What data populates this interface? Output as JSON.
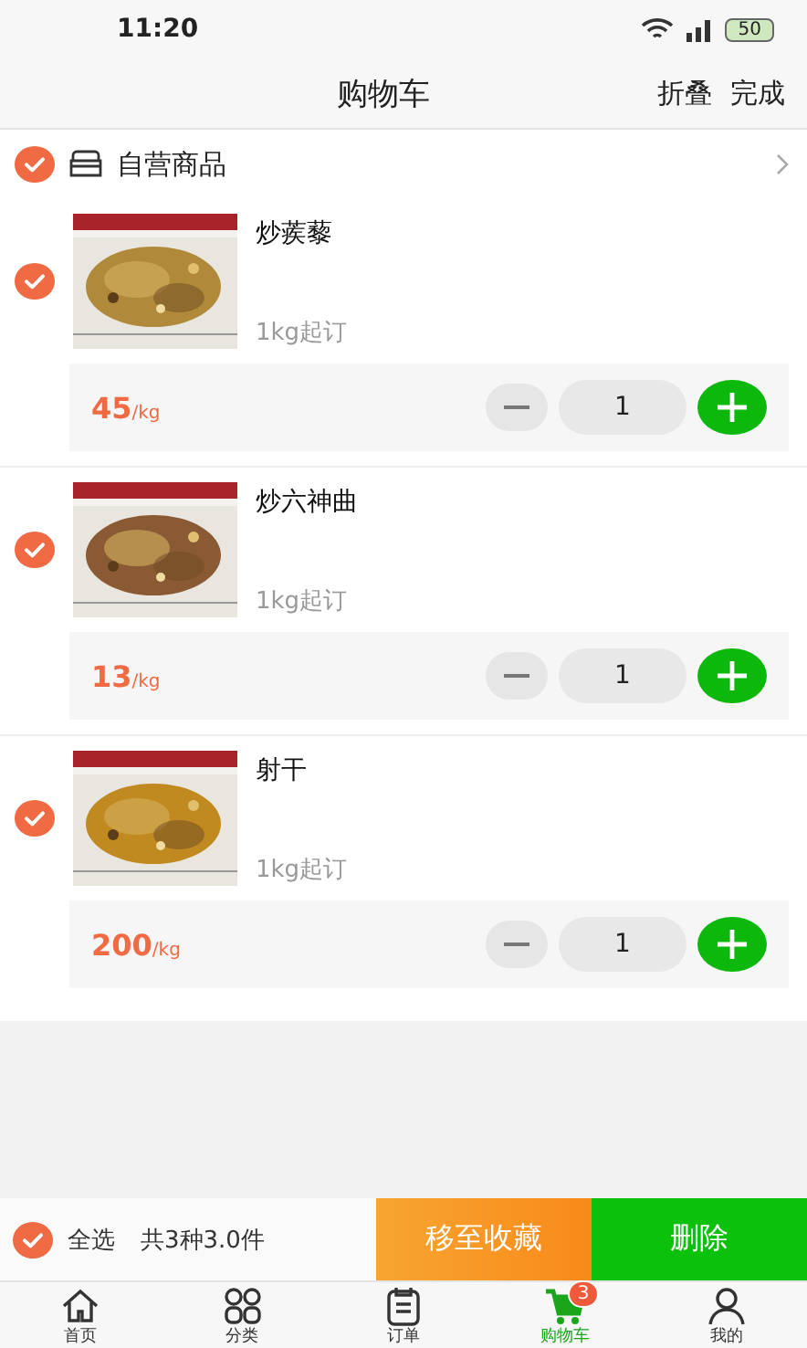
{
  "status_bar": {
    "time": "11:20",
    "battery": "50"
  },
  "header": {
    "title": "购物车",
    "actions": [
      "折叠",
      "完成"
    ]
  },
  "shop": {
    "name": "自营商品",
    "checked": true
  },
  "items": [
    {
      "name": "炒蒺藜",
      "min_order": "1kg起订",
      "price": "45",
      "unit": "/kg",
      "quantity": "1",
      "checked": true
    },
    {
      "name": "炒六神曲",
      "min_order": "1kg起订",
      "price": "13",
      "unit": "/kg",
      "quantity": "1",
      "checked": true
    },
    {
      "name": "射干",
      "min_order": "1kg起订",
      "price": "200",
      "unit": "/kg",
      "quantity": "1",
      "checked": true
    }
  ],
  "footer": {
    "select_all": {
      "label": "全选",
      "checked": true
    },
    "summary": "共3种3.0件",
    "buttons": [
      {
        "label": "移至收藏",
        "kind": "collect"
      },
      {
        "label": "删除",
        "kind": "delete"
      }
    ]
  },
  "tabs": [
    {
      "label": "首页",
      "kind": "home",
      "selected": false
    },
    {
      "label": "分类",
      "kind": "grid",
      "selected": false
    },
    {
      "label": "订单",
      "kind": "order",
      "selected": false
    },
    {
      "label": "购物车",
      "kind": "cart",
      "selected": true,
      "badge": "3"
    },
    {
      "label": "我的",
      "kind": "user",
      "selected": false
    }
  ]
}
